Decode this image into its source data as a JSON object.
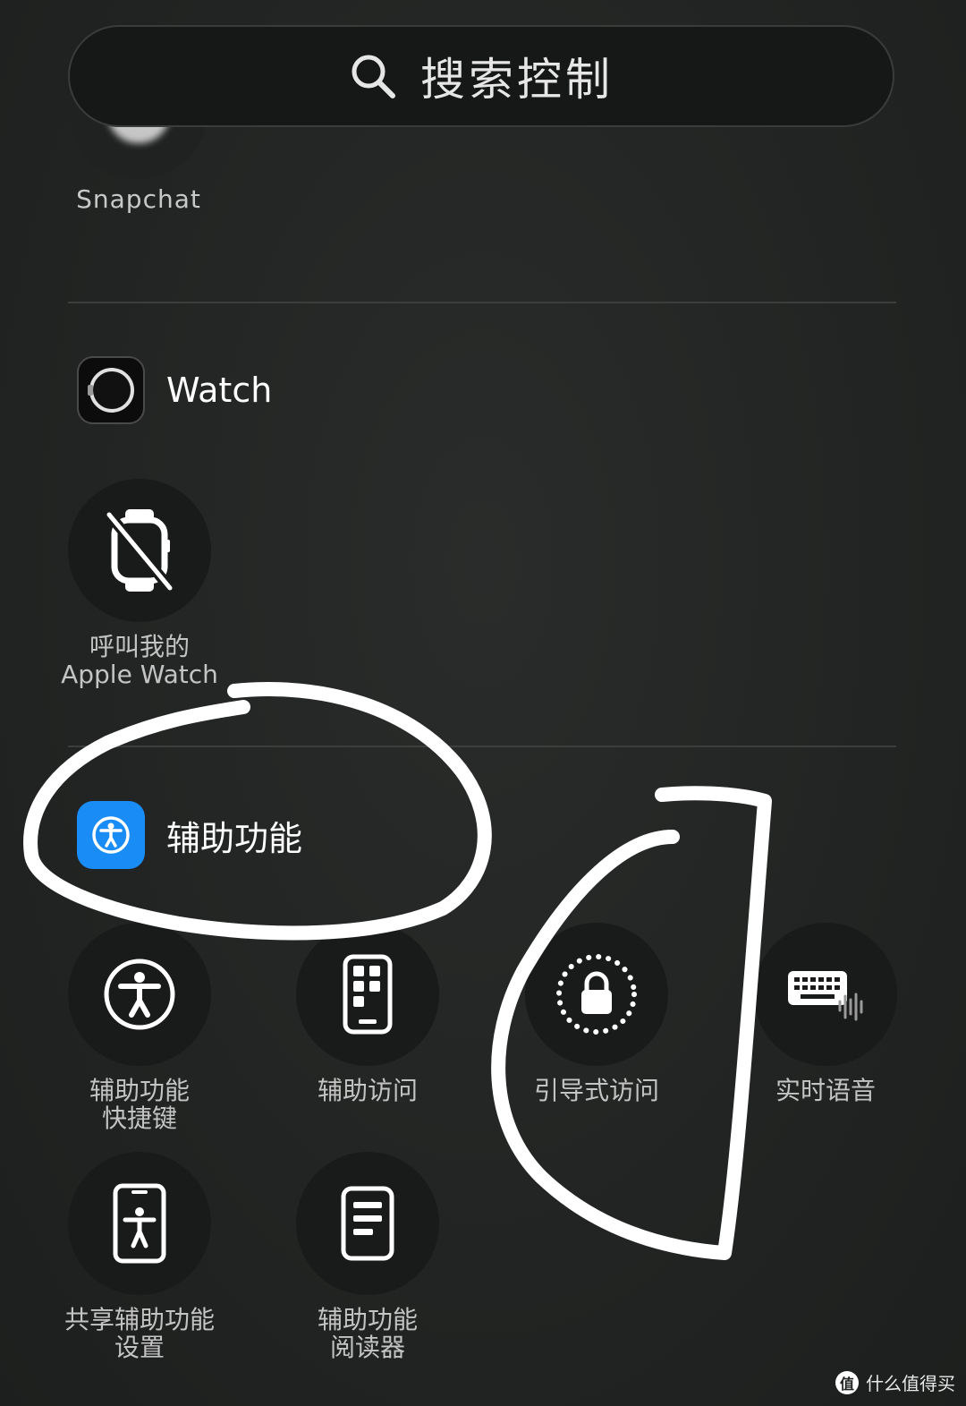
{
  "search": {
    "placeholder": "搜索控制",
    "icon": "search-icon"
  },
  "snapchat": {
    "label": "Snapchat"
  },
  "watch_section": {
    "title": "Watch",
    "icon": "watch-app-icon",
    "controls": [
      {
        "label_line1": "呼叫我的",
        "label_line2": "Apple Watch",
        "icon": "watch-slash-icon"
      }
    ]
  },
  "accessibility_section": {
    "title": "辅助功能",
    "icon": "accessibility-app-icon",
    "controls": [
      {
        "label_line1": "辅助功能",
        "label_line2": "快捷键",
        "icon": "accessibility-person-icon"
      },
      {
        "label_line1": "辅助访问",
        "label_line2": "",
        "icon": "assistive-access-icon"
      },
      {
        "label_line1": "引导式访问",
        "label_line2": "",
        "icon": "guided-access-lock-icon"
      },
      {
        "label_line1": "实时语音",
        "label_line2": "",
        "icon": "keyboard-waveform-icon"
      },
      {
        "label_line1": "共享辅助功能",
        "label_line2": "设置",
        "icon": "shared-accessibility-icon"
      },
      {
        "label_line1": "辅助功能",
        "label_line2": "阅读器",
        "icon": "reader-icon"
      }
    ]
  },
  "colors": {
    "background": "#222423",
    "accent": "#1a8cf5",
    "annotation": "#ffffff"
  },
  "watermark": {
    "badge": "值",
    "text": "什么值得买"
  }
}
